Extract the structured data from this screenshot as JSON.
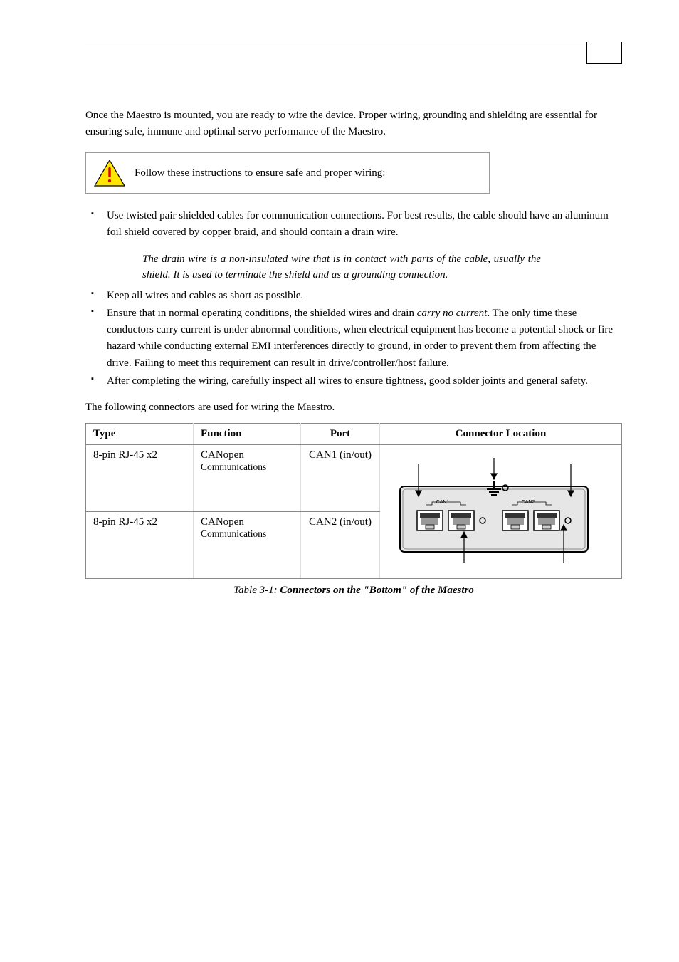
{
  "intro": "Once the Maestro is mounted, you are ready to wire the device. Proper wiring, grounding and shielding are essential for ensuring safe, immune and optimal servo performance of the Maestro.",
  "caution_text": "Follow these instructions to ensure safe and proper wiring:",
  "bullets_a": [
    "Use twisted pair shielded cables for communication connections. For best results, the cable should have an aluminum foil shield covered by copper braid, and should contain a drain wire."
  ],
  "definition": "The drain wire is a non-insulated wire that is in contact with parts of the cable, usually the shield. It is used to terminate the shield and as a grounding connection.",
  "bullets_b": [
    "Keep all wires and cables as short as possible.",
    "Ensure that in normal operating conditions, the shielded wires and drain <i>carry no current</i>. The only time these conductors carry current is under abnormal conditions, when electrical equipment has become a potential shock or fire hazard while conducting external EMI interferences directly to ground, in order to prevent them from affecting the drive. Failing to meet this requirement can result in drive/controller/host failure.",
    "After completing the wiring, carefully inspect all wires to ensure tightness, good solder joints and general safety."
  ],
  "following": "The following connectors are used for wiring the Maestro.",
  "table": {
    "headers": {
      "type": "Type",
      "function": "Function",
      "port": "Port",
      "location": "Connector Location"
    },
    "rows": [
      {
        "type": "8-pin RJ-45 x2",
        "function": "CANopen",
        "function_sub": "Communications",
        "port": "CAN1 (in/out)"
      },
      {
        "type": "8-pin RJ-45 x2",
        "function": "CANopen",
        "function_sub": "Communications",
        "port": "CAN2 (in/out)"
      }
    ]
  },
  "caption_prefix": "Table 3-1: ",
  "caption_bold": "Connectors on the \"Bottom\" of the Maestro",
  "diagram_labels": {
    "can1": "CAN1",
    "can2": "CAN2"
  }
}
